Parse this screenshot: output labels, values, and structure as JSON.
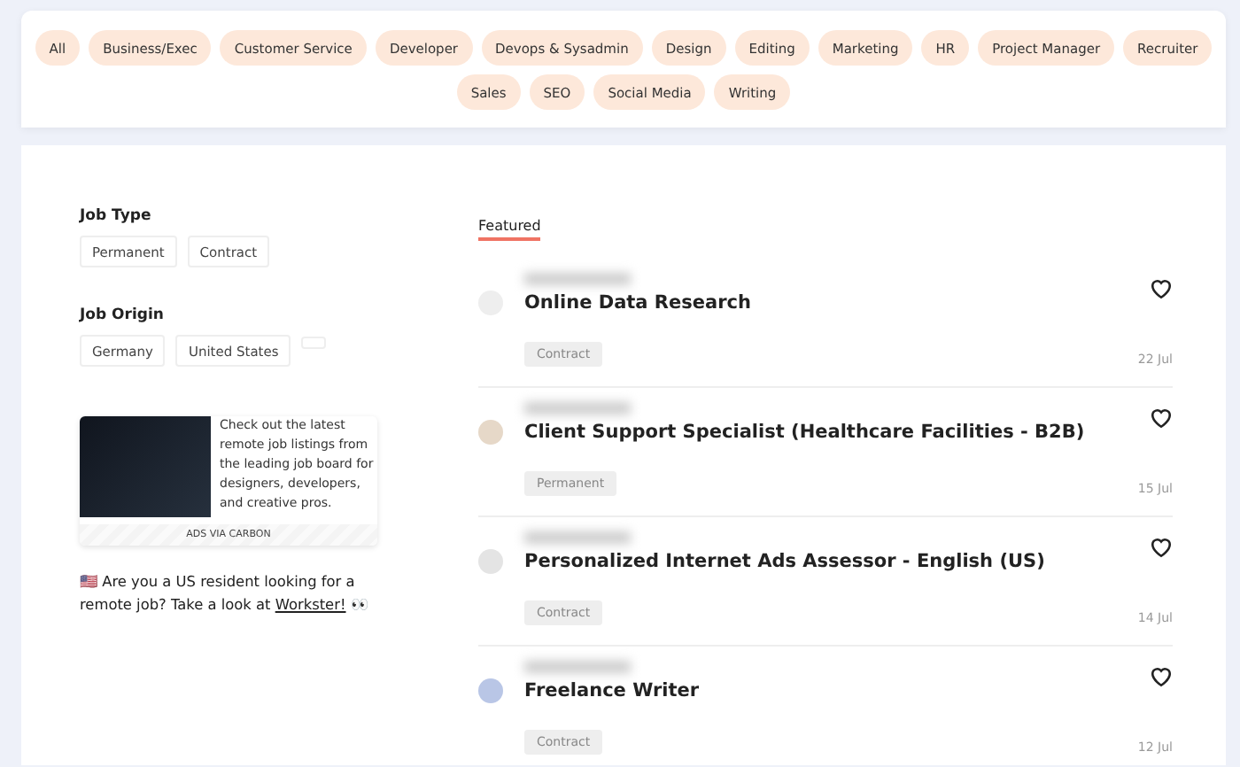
{
  "categories": [
    {
      "label": "All",
      "selected": false
    },
    {
      "label": "Business/Exec",
      "selected": false
    },
    {
      "label": "Customer Service",
      "selected": false
    },
    {
      "label": "Developer",
      "selected": false
    },
    {
      "label": "Devops & Sysadmin",
      "selected": false
    },
    {
      "label": "Design",
      "selected": false
    },
    {
      "label": "Editing",
      "selected": false
    },
    {
      "label": "Marketing",
      "selected": false
    },
    {
      "label": "HR",
      "selected": false
    },
    {
      "label": "Project Manager",
      "selected": false
    },
    {
      "label": "Recruiter",
      "selected": false
    },
    {
      "label": "Sales",
      "selected": false
    },
    {
      "label": "SEO",
      "selected": false
    },
    {
      "label": "Social Media",
      "selected": false
    },
    {
      "label": "Writing",
      "selected": false
    }
  ],
  "filters": [
    {
      "title": "Job Type",
      "options": [
        "Permanent",
        "Contract"
      ],
      "empty_chip": false
    },
    {
      "title": "Job Origin",
      "options": [
        "Germany",
        "United States"
      ],
      "empty_chip": true
    }
  ],
  "ad": {
    "text": "Check out the latest remote job listings from the leading job board for designers, developers, and creative pros.",
    "footer": "ADS VIA CARBON"
  },
  "promo": {
    "flag": "🇺🇸",
    "text": "Are you a US resident looking for a remote job? Take a look at",
    "link": "Workster!",
    "emoji": "👀"
  },
  "tabs": [
    {
      "label": "Featured",
      "selected": true
    }
  ],
  "jobs": [
    {
      "title": "Online Data Research",
      "type": "Contract",
      "date": "22 Jul",
      "color": "#eeeeee"
    },
    {
      "title": "Client Support Specialist (Healthcare Facilities - B2B)",
      "type": "Permanent",
      "date": "15 Jul",
      "color": "#e6d8c8"
    },
    {
      "title": "Personalized Internet Ads Assessor - English (US)",
      "type": "Contract",
      "date": "14 Jul",
      "color": "#e4e4e4"
    },
    {
      "title": "Freelance Writer",
      "type": "Contract",
      "date": "12 Jul",
      "color": "#b9c6e6"
    }
  ]
}
